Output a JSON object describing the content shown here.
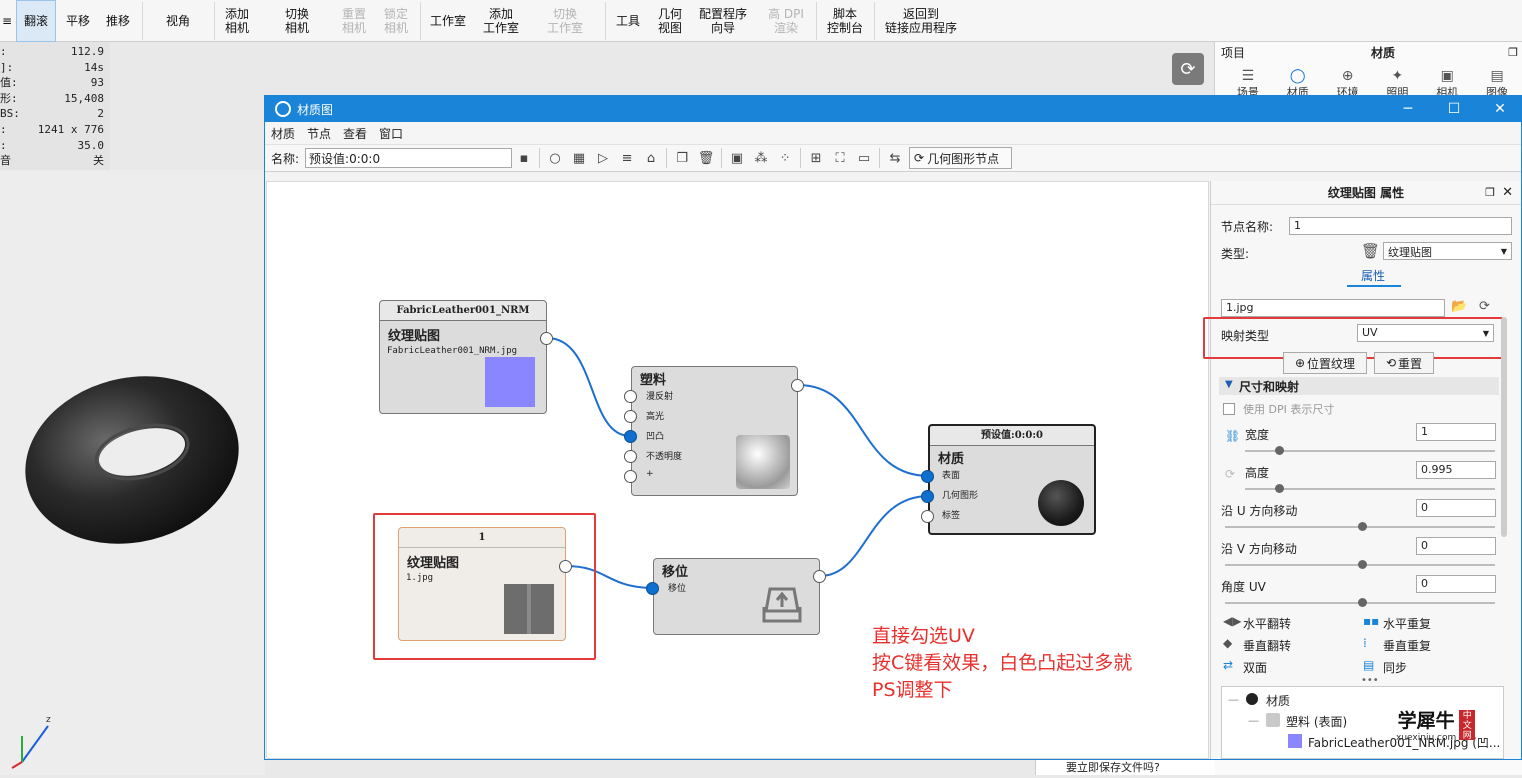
{
  "toolbar": {
    "items": [
      {
        "label": "翻滚"
      },
      {
        "label": "平移"
      },
      {
        "label": "推移"
      },
      {
        "label": "视角"
      },
      {
        "label": "添加\n相机"
      },
      {
        "label": "切换\n相机"
      },
      {
        "label": "重置\n相机"
      },
      {
        "label": "锁定\n相机"
      },
      {
        "label": "工作室"
      },
      {
        "label": "添加\n工作室"
      },
      {
        "label": "切换\n工作室"
      },
      {
        "label": "工具"
      },
      {
        "label": "几何\n视图"
      },
      {
        "label": "配置程序\n向导"
      },
      {
        "label": "高 DPI\n渲染"
      },
      {
        "label": "脚本\n控制台"
      },
      {
        "label": "返回到\n链接应用程序"
      }
    ]
  },
  "stats": [
    {
      "k": ":",
      "v": "112.9"
    },
    {
      "k": "]:",
      "v": "14s"
    },
    {
      "k": "值:",
      "v": "93"
    },
    {
      "k": "形:",
      "v": "15,408"
    },
    {
      "k": "BS:",
      "v": "2"
    },
    {
      "k": ":",
      "v": "1241 x 776"
    },
    {
      "k": ":",
      "v": "35.0"
    },
    {
      "k": "音",
      "v": "关"
    }
  ],
  "right_panel": {
    "project_label": "项目",
    "title": "材质",
    "tabs": [
      {
        "label": "场景",
        "icon": "list-icon"
      },
      {
        "label": "材质",
        "icon": "sphere-icon"
      },
      {
        "label": "环境",
        "icon": "globe-icon"
      },
      {
        "label": "照明",
        "icon": "bulb-icon"
      },
      {
        "label": "相机",
        "icon": "camera-icon"
      },
      {
        "label": "图像",
        "icon": "image-icon"
      }
    ]
  },
  "bottom_prompt": "要立即保存文件吗?",
  "window": {
    "title": "材质图",
    "menu": [
      "材质",
      "节点",
      "查看",
      "窗口"
    ],
    "name_label": "名称:",
    "name_value": "预设值:0:0:0",
    "geo_button": "几何图形节点"
  },
  "nodes": {
    "tex1": {
      "header": "FabricLeather001_NRM",
      "title": "纹理贴图",
      "file": "FabricLeather001_NRM.jpg",
      "swatch": "#8a86ff"
    },
    "plastic": {
      "title": "塑料",
      "ports": [
        "漫反射",
        "高光",
        "凹凸",
        "不透明度",
        "+"
      ]
    },
    "material": {
      "header": "预设值:0:0:0",
      "title": "材质",
      "ports": [
        "表面",
        "几何图形",
        "标签"
      ]
    },
    "tex2": {
      "header": "1",
      "title": "纹理贴图",
      "file": "1.jpg"
    },
    "move": {
      "title": "移位",
      "ports": [
        "移位"
      ]
    }
  },
  "annotation": [
    "直接勾选UV",
    "按C键看效果，白色凸起过多就",
    "PS调整下"
  ],
  "props": {
    "header": "纹理贴图 属性",
    "node_name_label": "节点名称:",
    "node_name_value": "1",
    "type_label": "类型:",
    "type_value": "纹理贴图",
    "tab": "属性",
    "file_value": "1.jpg",
    "mapping_label": "映射类型",
    "mapping_value": "UV",
    "pos_btn": "位置纹理",
    "reset_btn": "重置",
    "section": "尺寸和映射",
    "dpi_label": "使用 DPI 表示尺寸",
    "width_label": "宽度",
    "width_value": "1",
    "height_label": "高度",
    "height_value": "0.995",
    "u_label": "沿 U 方向移动",
    "u_value": "0",
    "v_label": "沿 V 方向移动",
    "v_value": "0",
    "angle_label": "角度 UV",
    "angle_value": "0",
    "opts": [
      "水平翻转",
      "水平重复",
      "垂直翻转",
      "垂直重复",
      "双面",
      "同步"
    ],
    "tree": [
      "材质",
      "塑料 (表面)",
      "FabricLeather001_NRM.jpg (凹..."
    ]
  },
  "watermark": {
    "text": "学犀牛",
    "sub": "xuexiniu.com",
    "badge": "中文网"
  }
}
